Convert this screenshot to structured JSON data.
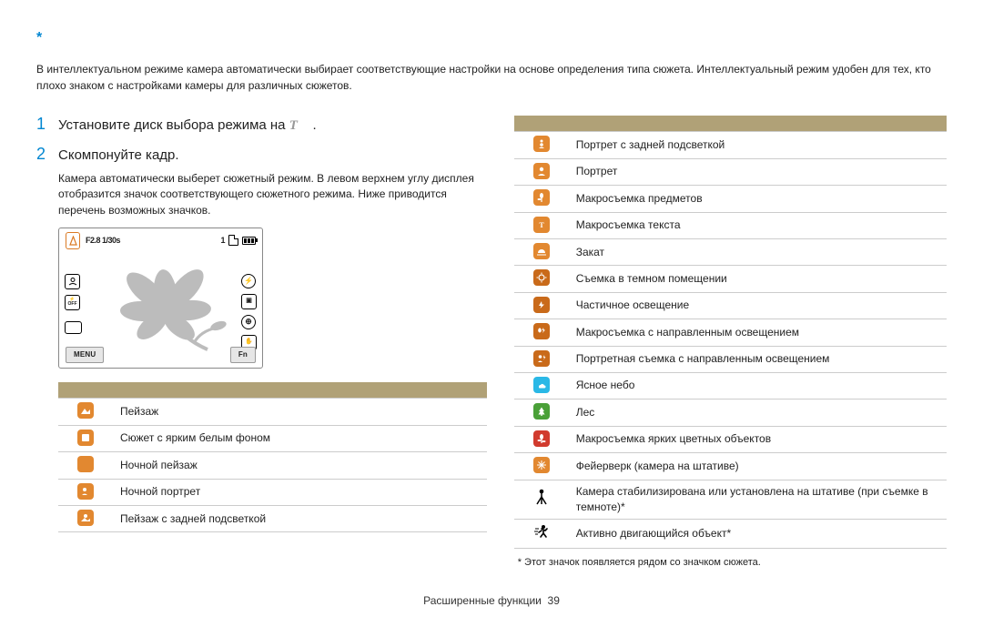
{
  "header_mark": "*",
  "intro_text": "В интеллектуальном режиме камера автоматически выбирает соответствующие настройки на основе определения типа сюжета. Интеллектуальный режим удобен для тех, кто плохо знаком с настройками камеры для различных сюжетов.",
  "steps": {
    "s1": {
      "num": "1",
      "text_pre": "Установите диск выбора режима на ",
      "text_post": "."
    },
    "s2": {
      "num": "2",
      "text": "Скомпонуйте кадр."
    }
  },
  "substep_text": "Камера автоматически выберет сюжетный режим. В левом верхнем углу дисплея отобразится значок соответствующего сюжетного режима. Ниже приводится перечень возможных значков.",
  "display": {
    "exposure": "F2.8 1/30s",
    "count": "1",
    "menu": "MENU",
    "fn": "Fn",
    "off": "OFF"
  },
  "left_icons": [
    {
      "key": "landscape",
      "label": "Пейзаж"
    },
    {
      "key": "white-bg",
      "label": "Сюжет с ярким белым фоном"
    },
    {
      "key": "night-landscape",
      "label": "Ночной пейзаж"
    },
    {
      "key": "night-portrait",
      "label": "Ночной портрет"
    },
    {
      "key": "backlit-landscape",
      "label": "Пейзаж с задней подсветкой"
    }
  ],
  "right_icons": [
    {
      "key": "backlit-portrait",
      "label": "Портрет с задней подсветкой"
    },
    {
      "key": "portrait",
      "label": "Портрет"
    },
    {
      "key": "macro-objects",
      "label": "Макросъемка предметов"
    },
    {
      "key": "macro-text",
      "label": "Макросъемка текста"
    },
    {
      "key": "sunset",
      "label": "Закат"
    },
    {
      "key": "dark-indoor",
      "label": "Съемка в темном помещении"
    },
    {
      "key": "partial-light",
      "label": "Частичное освещение"
    },
    {
      "key": "macro-spotlight",
      "label": "Макросъемка с направленным освещением"
    },
    {
      "key": "portrait-spotlight",
      "label": "Портретная съемка с направленным освещением"
    },
    {
      "key": "clear-sky",
      "label": "Ясное небо"
    },
    {
      "key": "forest",
      "label": "Лес"
    },
    {
      "key": "macro-color",
      "label": "Макросъемка ярких цветных объектов"
    },
    {
      "key": "fireworks",
      "label": "Фейерверк (камера на штативе)"
    },
    {
      "key": "tripod",
      "label": "Камера стабилизирована или установлена на штативе (при съемке в темноте)*"
    },
    {
      "key": "moving-subject",
      "label": "Активно двигающийся объект*"
    }
  ],
  "footnote": "* Этот значок появляется рядом со значком сюжета.",
  "footer": {
    "section": "Расширенные функции",
    "page": "39"
  }
}
